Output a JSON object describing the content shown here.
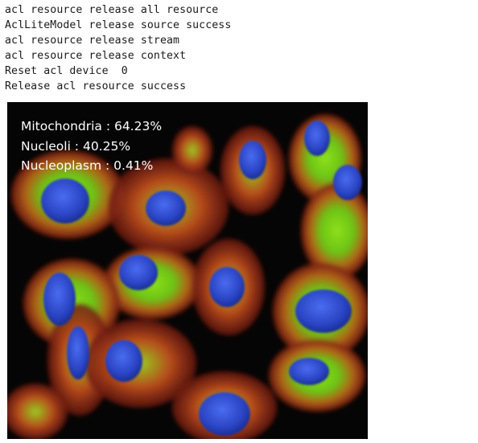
{
  "console": {
    "lines": [
      "acl resource release all resource",
      "AclLiteModel release source success",
      "acl resource release stream",
      "acl resource release context",
      "Reset acl device  0",
      "Release acl resource success"
    ]
  },
  "result_image": {
    "stats": [
      {
        "label": "Mitochondria",
        "value": "64.23%"
      },
      {
        "label": "Nucleoli",
        "value": "40.25%"
      },
      {
        "label": "Nucleoplasm",
        "value": "0.41%"
      }
    ],
    "stat_lines": [
      "Mitochondria : 64.23%",
      "Nucleoli : 40.25%",
      "Nucleoplasm : 0.41%"
    ],
    "colors": {
      "background": "#050505",
      "cytoplasm_red": "#b3331c",
      "cytoplasm_green": "#6fcf1a",
      "nucleus_blue": "#2a48c8"
    }
  }
}
